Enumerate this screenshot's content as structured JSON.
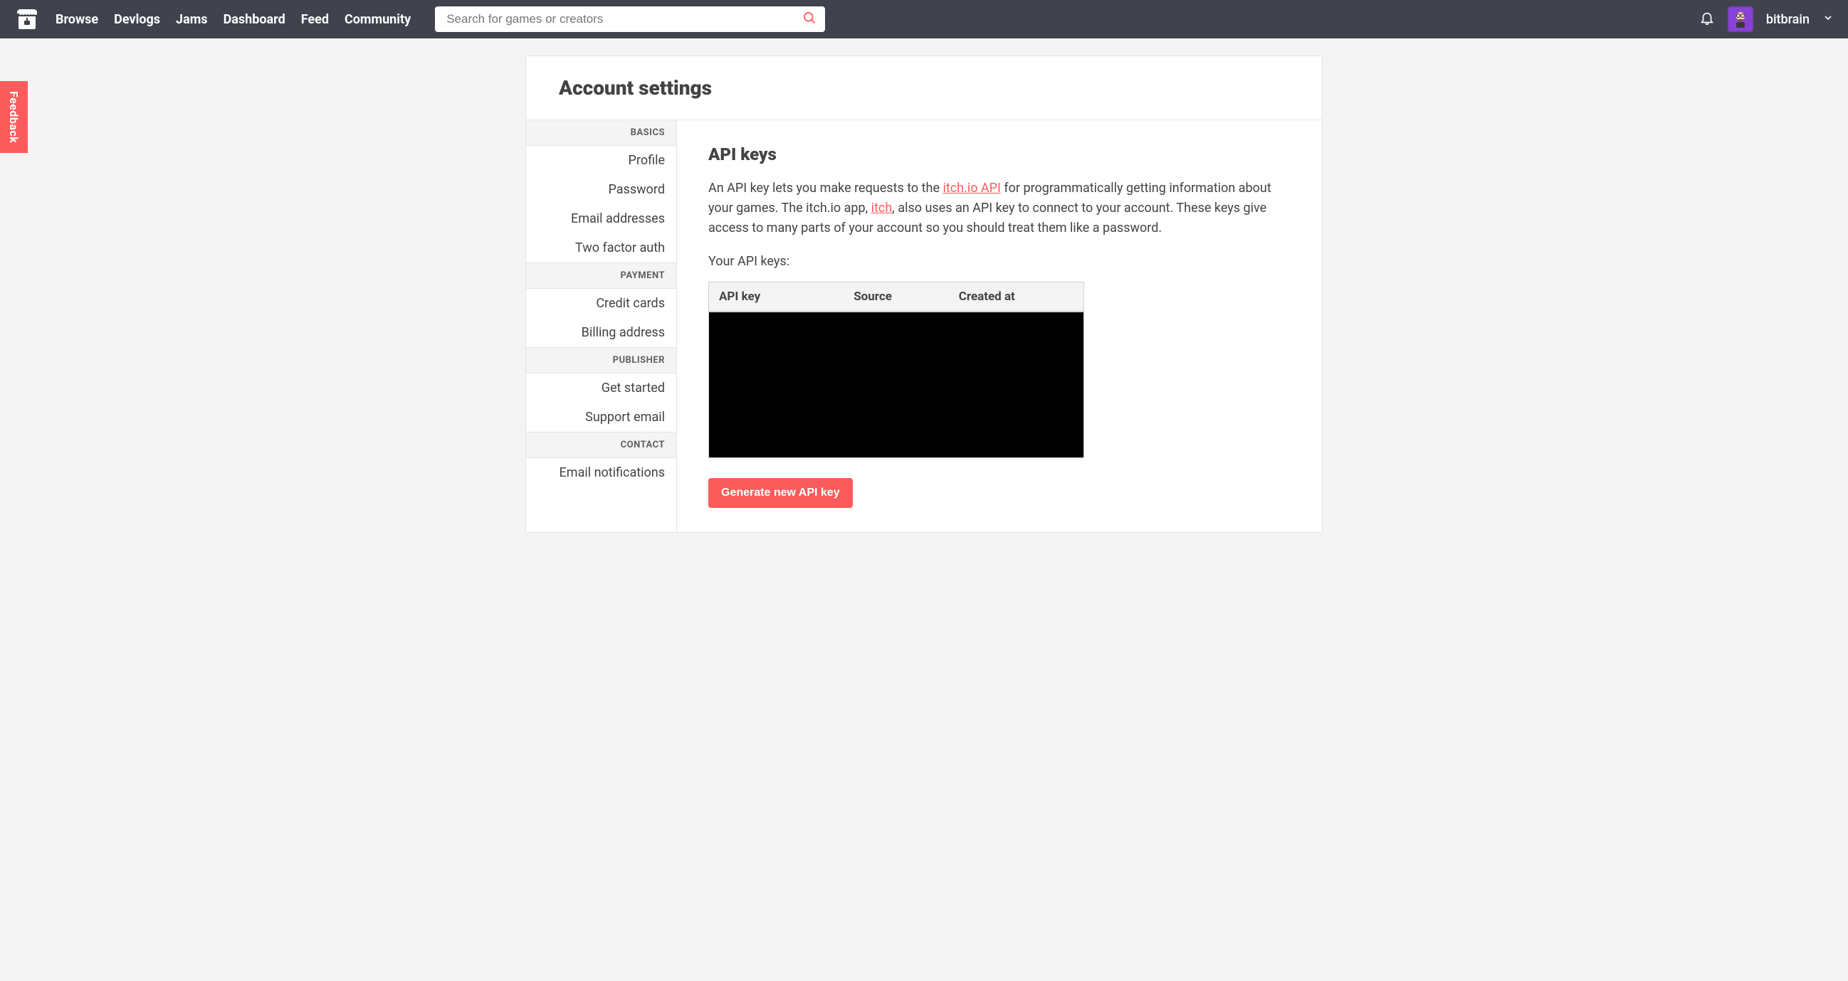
{
  "header": {
    "nav": [
      "Browse",
      "Devlogs",
      "Jams",
      "Dashboard",
      "Feed",
      "Community"
    ],
    "search_placeholder": "Search for games or creators",
    "username": "bitbrain"
  },
  "feedback_label": "Feedback",
  "page_title": "Account settings",
  "sidebar": {
    "sections": [
      {
        "header": "BASICS",
        "items": [
          "Profile",
          "Password",
          "Email addresses",
          "Two factor auth"
        ]
      },
      {
        "header": "PAYMENT",
        "items": [
          "Credit cards",
          "Billing address"
        ]
      },
      {
        "header": "PUBLISHER",
        "items": [
          "Get started",
          "Support email"
        ]
      },
      {
        "header": "CONTACT",
        "items": [
          "Email notifications"
        ]
      }
    ]
  },
  "content": {
    "heading": "API keys",
    "desc_part1": "An API key lets you make requests to the ",
    "desc_link1": "itch.io API",
    "desc_part2": " for programmatically getting information about your games. The itch.io app, ",
    "desc_link2": "itch",
    "desc_part3": ", also uses an API key to connect to your account. These keys give access to many parts of your account so you should treat them like a password.",
    "subhead": "Your API keys:",
    "table_headers": [
      "API key",
      "Source",
      "Created at"
    ],
    "generate_label": "Generate new API key"
  }
}
